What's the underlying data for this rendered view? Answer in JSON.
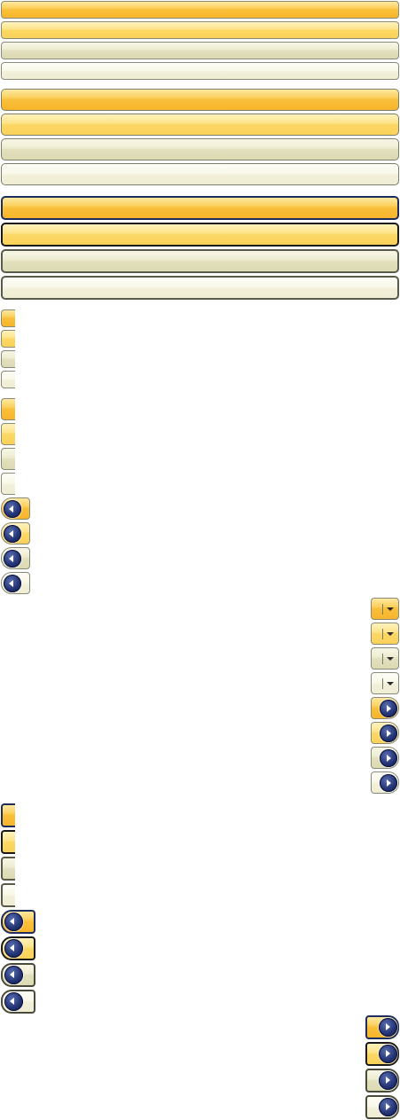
{
  "colors": {
    "orange": "#f9bf3a",
    "yellow": "#fbd763",
    "olive": "#e2e0bd",
    "cream": "#f2f0da",
    "border_gray": "#8a8a7a",
    "border_navy": "#1e2e5c",
    "circle_navy": "#233374"
  },
  "groups": [
    {
      "name": "bars-small",
      "kind": "bar",
      "states": [
        "orange",
        "yellow",
        "olive",
        "cream"
      ]
    },
    {
      "name": "bars-medium",
      "kind": "bar",
      "states": [
        "orange",
        "yellow",
        "olive",
        "cream"
      ]
    },
    {
      "name": "bars-large",
      "kind": "bar",
      "states": [
        "orange",
        "yellow",
        "olive",
        "cream"
      ]
    },
    {
      "name": "tabs-small",
      "kind": "tab",
      "states": [
        "orange",
        "yellow",
        "olive",
        "cream"
      ]
    },
    {
      "name": "tabs-medium",
      "kind": "tab",
      "states": [
        "orange",
        "yellow",
        "olive",
        "cream"
      ]
    },
    {
      "name": "back-buttons-small",
      "kind": "nav-left",
      "icon": "arrow-left-icon",
      "states": [
        "orange",
        "yellow",
        "olive",
        "cream"
      ]
    },
    {
      "name": "dropdown-buttons",
      "kind": "dropdown",
      "icon": "chevron-down-icon",
      "states": [
        "orange",
        "yellow",
        "olive",
        "cream"
      ]
    },
    {
      "name": "forward-buttons-small",
      "kind": "nav-right",
      "icon": "arrow-right-icon",
      "states": [
        "orange",
        "yellow",
        "olive",
        "cream"
      ]
    },
    {
      "name": "tabs-large",
      "kind": "tab",
      "states": [
        "orange",
        "yellow",
        "olive",
        "cream"
      ]
    },
    {
      "name": "back-buttons-large",
      "kind": "nav-left",
      "icon": "arrow-left-icon",
      "states": [
        "orange",
        "yellow",
        "olive",
        "cream"
      ]
    },
    {
      "name": "forward-buttons-large",
      "kind": "nav-right",
      "icon": "arrow-right-icon",
      "states": [
        "orange",
        "yellow",
        "olive",
        "cream"
      ]
    }
  ]
}
